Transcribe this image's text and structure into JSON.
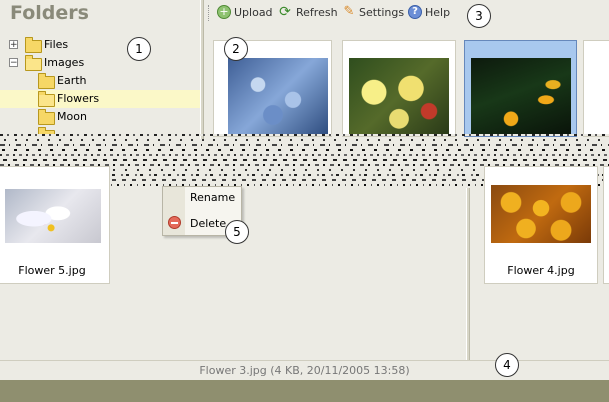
{
  "sidebar": {
    "title": "Folders",
    "tree": [
      {
        "label": "Files",
        "expander": "+"
      },
      {
        "label": "Images",
        "expander": "−"
      },
      {
        "label": "Earth"
      },
      {
        "label": "Flowers",
        "selected": true
      },
      {
        "label": "Moon"
      }
    ]
  },
  "toolbar": {
    "upload": "Upload",
    "refresh": "Refresh",
    "settings": "Settings",
    "help": "Help"
  },
  "thumbnails": [
    {
      "caption": "Flower 5.jpg"
    },
    {
      "caption": "Flower 4.jpg"
    }
  ],
  "context_menu": {
    "rename": "Rename",
    "delete": "Delete"
  },
  "status": {
    "text": "Flower 3.jpg (4 KB, 20/11/2005 13:58)"
  },
  "callouts": [
    "1",
    "2",
    "3",
    "4",
    "5"
  ],
  "colors": {
    "selection": "#a8c8ee",
    "footer": "#8f8f6f",
    "tree_highlight": "#fbf8c8"
  }
}
